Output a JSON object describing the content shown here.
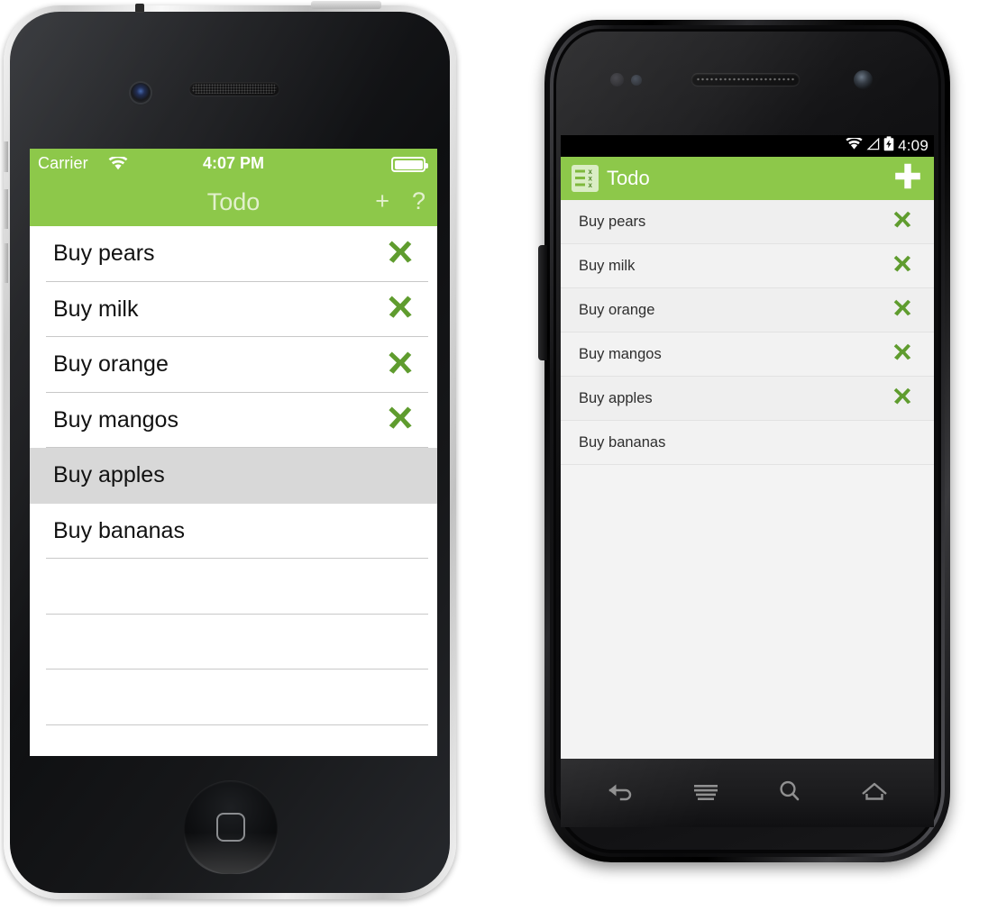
{
  "app": {
    "name": "Todo",
    "accent_color": "#8dc84a",
    "x_icon_color": "#5f9c2e"
  },
  "ios": {
    "device": "iphone",
    "status_bar": {
      "carrier": "Carrier",
      "wifi_icon": "wifi-icon",
      "time": "4:07 PM",
      "battery_icon": "battery-full-icon"
    },
    "nav_bar": {
      "title": "Todo",
      "add_label": "+",
      "help_label": "?"
    },
    "items": [
      {
        "label": "Buy pears",
        "has_delete": true,
        "selected": false
      },
      {
        "label": "Buy milk",
        "has_delete": true,
        "selected": false
      },
      {
        "label": "Buy orange",
        "has_delete": true,
        "selected": false
      },
      {
        "label": "Buy mangos",
        "has_delete": true,
        "selected": false
      },
      {
        "label": "Buy apples",
        "has_delete": false,
        "selected": true
      },
      {
        "label": "Buy bananas",
        "has_delete": false,
        "selected": false
      },
      {
        "label": "",
        "has_delete": false,
        "selected": false
      },
      {
        "label": "",
        "has_delete": false,
        "selected": false
      },
      {
        "label": "",
        "has_delete": false,
        "selected": false
      },
      {
        "label": "",
        "has_delete": false,
        "selected": false
      }
    ],
    "delete_icon": "x-delete-icon",
    "home_button": "home-button"
  },
  "android": {
    "device": "android-phone",
    "status_bar": {
      "wifi_icon": "wifi-icon",
      "signal_icon": "signal-icon",
      "battery_icon": "battery-charging-icon",
      "time": "4:09"
    },
    "action_bar": {
      "app_icon": "todo-app-icon",
      "title": "Todo",
      "add_label": "add-button"
    },
    "items": [
      {
        "label": "Buy pears",
        "has_delete": true
      },
      {
        "label": "Buy milk",
        "has_delete": true
      },
      {
        "label": "Buy orange",
        "has_delete": true
      },
      {
        "label": "Buy mangos",
        "has_delete": true
      },
      {
        "label": "Buy apples",
        "has_delete": true
      },
      {
        "label": "Buy bananas",
        "has_delete": false
      }
    ],
    "delete_icon": "x-delete-icon",
    "nav_buttons": [
      {
        "name": "back-button",
        "icon": "back-arrow-icon"
      },
      {
        "name": "menu-button",
        "icon": "hamburger-menu-icon"
      },
      {
        "name": "search-button",
        "icon": "search-icon"
      },
      {
        "name": "home-button",
        "icon": "home-icon"
      }
    ]
  }
}
